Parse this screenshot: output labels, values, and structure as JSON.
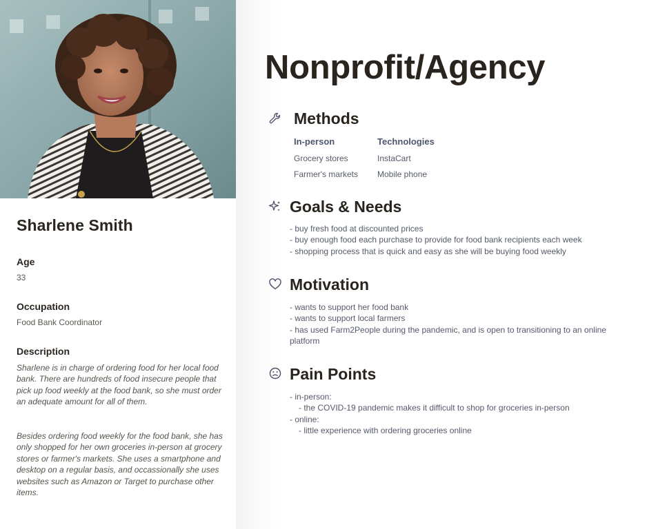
{
  "persona": {
    "name": "Sharlene Smith",
    "age_label": "Age",
    "age": "33",
    "occupation_label": "Occupation",
    "occupation": "Food Bank Coordinator",
    "description_label": "Description",
    "description_p1": "Sharlene is in charge of ordering food for her local food bank. There are hundreds of food insecure people that pick up food weekly at the food bank, so she must order an adequate amount for all of them.",
    "description_p2": "Besides ordering food weekly for the food bank, she has only shopped for her own groceries in-person at grocery stores or farmer's markets. She uses a smartphone and desktop on a regular basis, and occassionally she uses websites such as Amazon or Target to purchase other items."
  },
  "page_title": "Nonprofit/Agency",
  "methods": {
    "icon": "wrench-icon",
    "title": "Methods",
    "in_person_label": "In-person",
    "in_person": [
      "Grocery stores",
      "Farmer's markets"
    ],
    "technologies_label": "Technologies",
    "technologies": [
      "InstaCart",
      "Mobile phone"
    ]
  },
  "goals": {
    "icon": "sparkle-icon",
    "title": "Goals & Needs",
    "items": [
      "- buy fresh food at discounted prices",
      "- buy enough food each purchase to provide for food bank recipients each week",
      "- shopping process that is quick and easy as she will be buying food weekly"
    ]
  },
  "motivation": {
    "icon": "heart-icon",
    "title": "Motivation",
    "items": [
      "- wants to support her food bank",
      "- wants to support local farmers",
      "- has used Farm2People during the pandemic, and is open to transitioning to an online platform"
    ]
  },
  "pain_points": {
    "icon": "frown-face-icon",
    "title": "Pain Points",
    "in_person_label": "- in-person:",
    "in_person_item": "- the COVID-19 pandemic makes it difficult to shop for groceries in-person",
    "online_label": "- online:",
    "online_item": "- little experience with ordering groceries online"
  }
}
